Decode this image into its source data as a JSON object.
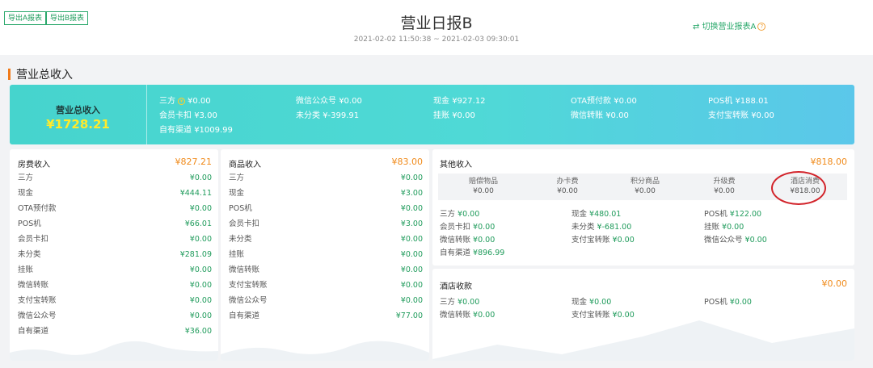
{
  "header": {
    "export_a": "导出A报表",
    "export_b": "导出B报表",
    "title": "营业日报B",
    "date_range": "2021-02-02 11:50:38 ~ 2021-02-03 09:30:01",
    "switch_label": "⇄ 切换营业报表A",
    "help_glyph": "?"
  },
  "section_title": "营业总收入",
  "summary": {
    "total_label": "营业总收入",
    "total_value": "¥1728.21",
    "items": [
      {
        "label": "三方",
        "value": "¥0.00"
      },
      {
        "label": "微信公众号",
        "value": "¥0.00"
      },
      {
        "label": "现金",
        "value": "¥927.12"
      },
      {
        "label": "OTA预付款",
        "value": "¥0.00"
      },
      {
        "label": "POS机",
        "value": "¥188.01"
      },
      {
        "label": "会员卡扣",
        "value": "¥3.00"
      },
      {
        "label": "未分类",
        "value": "¥-399.91"
      },
      {
        "label": "挂账",
        "value": "¥0.00"
      },
      {
        "label": "微信转账",
        "value": "¥0.00"
      },
      {
        "label": "支付宝转账",
        "value": "¥0.00"
      },
      {
        "label": "自有渠道",
        "value": "¥1009.99"
      }
    ]
  },
  "room": {
    "title": "房费收入",
    "total": "¥827.21",
    "rows": [
      {
        "label": "三方",
        "value": "¥0.00"
      },
      {
        "label": "现金",
        "value": "¥444.11"
      },
      {
        "label": "OTA预付款",
        "value": "¥0.00"
      },
      {
        "label": "POS机",
        "value": "¥66.01"
      },
      {
        "label": "会员卡扣",
        "value": "¥0.00"
      },
      {
        "label": "未分类",
        "value": "¥281.09"
      },
      {
        "label": "挂账",
        "value": "¥0.00"
      },
      {
        "label": "微信转账",
        "value": "¥0.00"
      },
      {
        "label": "支付宝转账",
        "value": "¥0.00"
      },
      {
        "label": "微信公众号",
        "value": "¥0.00"
      },
      {
        "label": "自有渠道",
        "value": "¥36.00"
      }
    ]
  },
  "goods": {
    "title": "商品收入",
    "total": "¥83.00",
    "rows": [
      {
        "label": "三方",
        "value": "¥0.00"
      },
      {
        "label": "现金",
        "value": "¥3.00"
      },
      {
        "label": "POS机",
        "value": "¥0.00"
      },
      {
        "label": "会员卡扣",
        "value": "¥3.00"
      },
      {
        "label": "未分类",
        "value": "¥0.00"
      },
      {
        "label": "挂账",
        "value": "¥0.00"
      },
      {
        "label": "微信转账",
        "value": "¥0.00"
      },
      {
        "label": "支付宝转账",
        "value": "¥0.00"
      },
      {
        "label": "微信公众号",
        "value": "¥0.00"
      },
      {
        "label": "自有渠道",
        "value": "¥77.00"
      }
    ]
  },
  "other": {
    "title": "其他收入",
    "total": "¥818.00",
    "subcats": [
      {
        "label": "赔偿物品",
        "value": "¥0.00"
      },
      {
        "label": "办卡费",
        "value": "¥0.00"
      },
      {
        "label": "积分商品",
        "value": "¥0.00"
      },
      {
        "label": "升级费",
        "value": "¥0.00"
      },
      {
        "label": "酒店消费",
        "value": "¥818.00"
      }
    ],
    "payments": [
      {
        "label": "三方",
        "value": "¥0.00"
      },
      {
        "label": "现金",
        "value": "¥480.01"
      },
      {
        "label": "POS机",
        "value": "¥122.00"
      },
      {
        "label": "会员卡扣",
        "value": "¥0.00"
      },
      {
        "label": "未分类",
        "value": "¥-681.00"
      },
      {
        "label": "挂账",
        "value": "¥0.00"
      },
      {
        "label": "微信转账",
        "value": "¥0.00"
      },
      {
        "label": "支付宝转账",
        "value": "¥0.00"
      },
      {
        "label": "微信公众号",
        "value": "¥0.00"
      },
      {
        "label": "自有渠道",
        "value": "¥896.99"
      }
    ]
  },
  "hotel_receipts": {
    "title": "酒店收款",
    "total": "¥0.00",
    "payments": [
      {
        "label": "三方",
        "value": "¥0.00"
      },
      {
        "label": "现金",
        "value": "¥0.00"
      },
      {
        "label": "POS机",
        "value": "¥0.00"
      },
      {
        "label": "微信转账",
        "value": "¥0.00"
      },
      {
        "label": "支付宝转账",
        "value": "¥0.00"
      }
    ]
  },
  "colors": {
    "accent_green": "#1f9b5b",
    "amount_orange": "#f08a1a",
    "banner_start": "#46d4cd",
    "banner_end": "#5bc7ea",
    "highlight_yellow": "#ffea2b",
    "circle_red": "#d2232a"
  }
}
